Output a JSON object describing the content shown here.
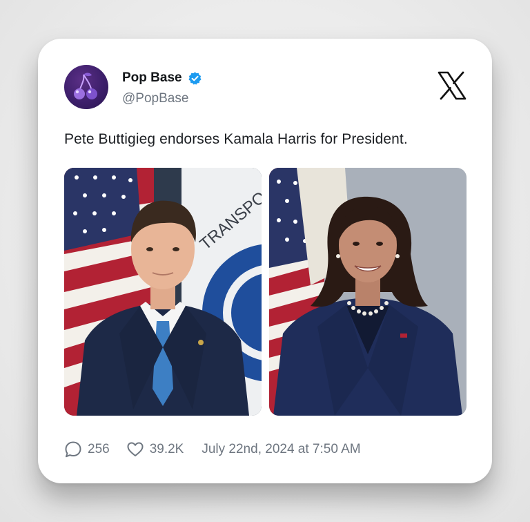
{
  "account": {
    "display_name": "Pop Base",
    "handle": "@PopBase",
    "avatar_icon": "cherries-icon",
    "verified_color": "#1d9bf0"
  },
  "post": {
    "text": "Pete Buttigieg endorses Kamala Harris for President.",
    "images": [
      {
        "subject": "man-portrait-with-flags"
      },
      {
        "subject": "woman-portrait-with-flags"
      }
    ]
  },
  "stats": {
    "replies": "256",
    "likes": "39.2K",
    "timestamp": "July 22nd, 2024 at 7:50 AM"
  },
  "brand": {
    "logo_icon": "x-logo-icon"
  }
}
